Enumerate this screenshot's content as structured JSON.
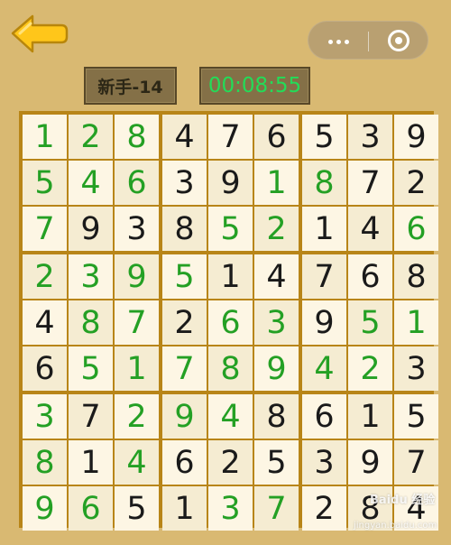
{
  "header": {
    "level_label": "新手-14",
    "timer": "00:08:55"
  },
  "colors": {
    "background": "#d9b972",
    "given_digit": "#1a1a1a",
    "filled_digit": "#24a024",
    "timer_text": "#23dc58",
    "grid_line": "#b88518"
  },
  "icons": {
    "back": "back-arrow-icon",
    "more": "more-dots-icon",
    "close": "target-close-icon"
  },
  "board": {
    "rows": [
      [
        "1",
        "2",
        "8",
        "4",
        "7",
        "6",
        "5",
        "3",
        "9"
      ],
      [
        "5",
        "4",
        "6",
        "3",
        "9",
        "1",
        "8",
        "7",
        "2"
      ],
      [
        "7",
        "9",
        "3",
        "8",
        "5",
        "2",
        "1",
        "4",
        "6"
      ],
      [
        "2",
        "3",
        "9",
        "5",
        "1",
        "4",
        "7",
        "6",
        "8"
      ],
      [
        "4",
        "8",
        "7",
        "2",
        "6",
        "3",
        "9",
        "5",
        "1"
      ],
      [
        "6",
        "5",
        "1",
        "7",
        "8",
        "9",
        "4",
        "2",
        "3"
      ],
      [
        "3",
        "7",
        "2",
        "9",
        "4",
        "8",
        "6",
        "1",
        "5"
      ],
      [
        "8",
        "1",
        "4",
        "6",
        "2",
        "5",
        "3",
        "9",
        "7"
      ],
      [
        "9",
        "6",
        "5",
        "1",
        "3",
        "7",
        "2",
        "8",
        "4"
      ]
    ],
    "filled": [
      [
        1,
        1,
        1,
        0,
        0,
        0,
        0,
        0,
        0
      ],
      [
        1,
        1,
        1,
        0,
        0,
        1,
        1,
        0,
        0
      ],
      [
        1,
        0,
        0,
        0,
        1,
        1,
        0,
        0,
        1
      ],
      [
        1,
        1,
        1,
        1,
        0,
        0,
        0,
        0,
        0
      ],
      [
        0,
        1,
        1,
        0,
        1,
        1,
        0,
        1,
        1
      ],
      [
        0,
        1,
        1,
        1,
        1,
        1,
        1,
        1,
        0
      ],
      [
        1,
        0,
        1,
        1,
        1,
        0,
        0,
        0,
        0
      ],
      [
        1,
        0,
        1,
        0,
        0,
        0,
        0,
        0,
        0
      ],
      [
        1,
        1,
        0,
        0,
        1,
        1,
        0,
        0,
        0
      ]
    ]
  },
  "watermark": {
    "line1": "Baidu 经验",
    "line2": "jingyan.baidu.com"
  }
}
